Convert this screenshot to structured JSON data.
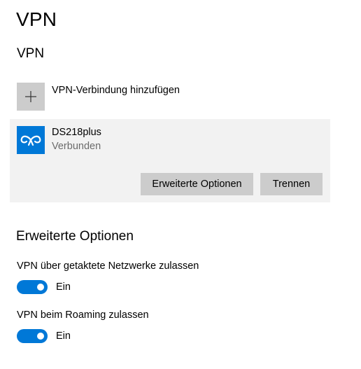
{
  "page": {
    "title": "VPN"
  },
  "vpn_section": {
    "title": "VPN"
  },
  "add_connection": {
    "label": "VPN-Verbindung hinzufügen",
    "icon": "plus-icon"
  },
  "connection": {
    "name": "DS218plus",
    "status": "Verbunden",
    "icon": "vpn-icon",
    "accent_color": "#0078d7",
    "buttons": {
      "advanced": "Erweiterte Optionen",
      "disconnect": "Trennen"
    }
  },
  "advanced_section": {
    "title": "Erweiterte Optionen",
    "settings": [
      {
        "label": "VPN über getaktete Netzwerke zulassen",
        "state": "Ein",
        "on": true
      },
      {
        "label": "VPN beim Roaming zulassen",
        "state": "Ein",
        "on": true
      }
    ]
  }
}
